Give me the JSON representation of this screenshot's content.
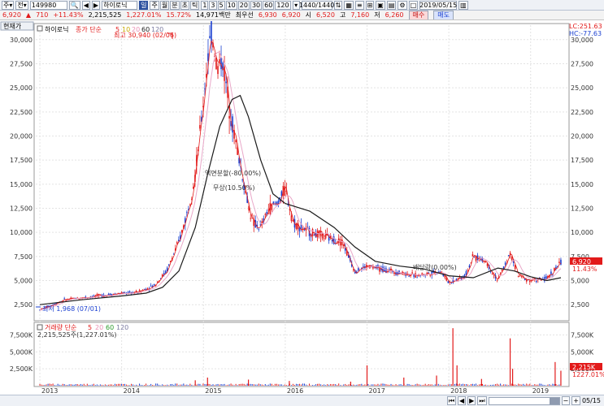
{
  "toolbar": {
    "period": "주",
    "market": "전",
    "code": "149980",
    "name": "하이로닉",
    "chart_type": "일",
    "intervals": [
      "주",
      "월",
      "분",
      "초",
      "틱"
    ],
    "minute_steps": [
      "1",
      "3",
      "5",
      "10",
      "20",
      "30",
      "60",
      "120"
    ],
    "bar_count": "1440/1440",
    "date": "2019/05/15"
  },
  "quote": {
    "price": "6,920",
    "change_arrow": "▲",
    "change": "710",
    "change_pct": "+11.43%",
    "volume": "2,215,525",
    "volume_pct": "1,227.01%",
    "turnover": "15.72%",
    "amount": "14,971백만",
    "label_priority": "최우선",
    "ask": "6,930",
    "bid": "6,920",
    "open_label": "시",
    "open": "6,520",
    "high_label": "고",
    "high": "7,160",
    "low_label": "저",
    "low": "6,260",
    "buy_label": "매수",
    "sell_label": "매도"
  },
  "price_panel": {
    "left_badge": "현재가",
    "legend_name": "하이로닉",
    "legend_prefix": "종가 단순",
    "ma_periods": [
      "5",
      "10",
      "20",
      "60",
      "120"
    ],
    "lc": "LC:251.63",
    "hc": "HC:-77.63",
    "current_tag": "6,920",
    "current_pct": "11.43%",
    "high_note": "최고 30,940 (02/06)",
    "low_note": "최저 1,968 (07/01)",
    "ann_split": "액면분할(-80.00%)",
    "ann_bonus": "무상(10.50%)",
    "ann_dividend": "배당락(0.00%)"
  },
  "volume_panel": {
    "legend": "거래량 단순",
    "ma_periods": [
      "5",
      "20",
      "60",
      "120"
    ],
    "current_vol": "2,215,525주(1,227.01%)",
    "tag_vol": "2,215K",
    "tag_pct": "1227.01%"
  },
  "bottom": {
    "date_end": "05/15"
  },
  "colors": {
    "up": "#e21a1a",
    "down": "#1a3fd0",
    "ma5": "#e21a1a",
    "ma10": "#e8c800",
    "ma20": "#e9a8c9",
    "ma60": "#1b1b1b",
    "ma120": "#7a7aa0"
  },
  "chart_data": [
    {
      "type": "line",
      "x_labels": [
        "2013",
        "2014",
        "2015",
        "2016",
        "2017",
        "2018",
        "2019"
      ],
      "ylim": [
        1000,
        31500
      ],
      "y_ticks": [
        "2,500",
        "5,000",
        "7,500",
        "10,000",
        "12,500",
        "15,000",
        "17,500",
        "20,000",
        "22,500",
        "25,000",
        "27,500",
        "30,000"
      ],
      "close": [
        {
          "x": 2013.0,
          "y": 1968
        },
        {
          "x": 2013.3,
          "y": 3000
        },
        {
          "x": 2013.6,
          "y": 3300
        },
        {
          "x": 2013.9,
          "y": 3600
        },
        {
          "x": 2014.2,
          "y": 3800
        },
        {
          "x": 2014.4,
          "y": 4500
        },
        {
          "x": 2014.55,
          "y": 6000
        },
        {
          "x": 2014.7,
          "y": 9000
        },
        {
          "x": 2014.8,
          "y": 12000
        },
        {
          "x": 2014.9,
          "y": 16000
        },
        {
          "x": 2014.98,
          "y": 22000
        },
        {
          "x": 2015.05,
          "y": 28000
        },
        {
          "x": 2015.1,
          "y": 30940
        },
        {
          "x": 2015.17,
          "y": 27000
        },
        {
          "x": 2015.23,
          "y": 28000
        },
        {
          "x": 2015.3,
          "y": 24000
        },
        {
          "x": 2015.38,
          "y": 20000
        },
        {
          "x": 2015.45,
          "y": 17000
        },
        {
          "x": 2015.52,
          "y": 14000
        },
        {
          "x": 2015.6,
          "y": 11000
        },
        {
          "x": 2015.7,
          "y": 10500
        },
        {
          "x": 2015.8,
          "y": 12500
        },
        {
          "x": 2015.9,
          "y": 13000
        },
        {
          "x": 2016.0,
          "y": 14500
        },
        {
          "x": 2016.1,
          "y": 11000
        },
        {
          "x": 2016.3,
          "y": 10000
        },
        {
          "x": 2016.5,
          "y": 9500
        },
        {
          "x": 2016.7,
          "y": 9000
        },
        {
          "x": 2016.85,
          "y": 6000
        },
        {
          "x": 2017.0,
          "y": 6500
        },
        {
          "x": 2017.3,
          "y": 6000
        },
        {
          "x": 2017.6,
          "y": 5500
        },
        {
          "x": 2017.9,
          "y": 6000
        },
        {
          "x": 2018.0,
          "y": 4800
        },
        {
          "x": 2018.2,
          "y": 5500
        },
        {
          "x": 2018.3,
          "y": 7500
        },
        {
          "x": 2018.45,
          "y": 7000
        },
        {
          "x": 2018.6,
          "y": 5000
        },
        {
          "x": 2018.75,
          "y": 7800
        },
        {
          "x": 2018.85,
          "y": 5500
        },
        {
          "x": 2019.0,
          "y": 5000
        },
        {
          "x": 2019.2,
          "y": 5200
        },
        {
          "x": 2019.37,
          "y": 6920
        }
      ],
      "ma60": [
        {
          "x": 2013.0,
          "y": 2500
        },
        {
          "x": 2013.5,
          "y": 3000
        },
        {
          "x": 2014.0,
          "y": 3400
        },
        {
          "x": 2014.3,
          "y": 3700
        },
        {
          "x": 2014.5,
          "y": 4300
        },
        {
          "x": 2014.7,
          "y": 6000
        },
        {
          "x": 2014.9,
          "y": 10500
        },
        {
          "x": 2015.05,
          "y": 16000
        },
        {
          "x": 2015.2,
          "y": 21000
        },
        {
          "x": 2015.35,
          "y": 23800
        },
        {
          "x": 2015.45,
          "y": 24200
        },
        {
          "x": 2015.55,
          "y": 22000
        },
        {
          "x": 2015.7,
          "y": 17500
        },
        {
          "x": 2015.85,
          "y": 14000
        },
        {
          "x": 2016.0,
          "y": 13000
        },
        {
          "x": 2016.3,
          "y": 12200
        },
        {
          "x": 2016.6,
          "y": 10500
        },
        {
          "x": 2016.85,
          "y": 8500
        },
        {
          "x": 2017.1,
          "y": 7000
        },
        {
          "x": 2017.4,
          "y": 6500
        },
        {
          "x": 2017.7,
          "y": 6200
        },
        {
          "x": 2018.0,
          "y": 5500
        },
        {
          "x": 2018.3,
          "y": 5300
        },
        {
          "x": 2018.6,
          "y": 6300
        },
        {
          "x": 2018.8,
          "y": 6000
        },
        {
          "x": 2019.0,
          "y": 5400
        },
        {
          "x": 2019.2,
          "y": 5000
        },
        {
          "x": 2019.37,
          "y": 5300
        }
      ]
    },
    {
      "type": "bar",
      "x_labels": [
        "2013",
        "2014",
        "2015",
        "2016",
        "2017",
        "2018",
        "2019"
      ],
      "ylim": [
        0,
        9000
      ],
      "y_ticks": [
        "2,500K",
        "5,000K",
        "7,500K"
      ],
      "spikes": [
        {
          "x": 2014.9,
          "y": 800
        },
        {
          "x": 2015.05,
          "y": 1200
        },
        {
          "x": 2015.55,
          "y": 900
        },
        {
          "x": 2016.05,
          "y": 700
        },
        {
          "x": 2016.8,
          "y": 600
        },
        {
          "x": 2017.0,
          "y": 3000
        },
        {
          "x": 2017.45,
          "y": 1200
        },
        {
          "x": 2017.85,
          "y": 1500
        },
        {
          "x": 2018.05,
          "y": 8500
        },
        {
          "x": 2018.1,
          "y": 3000
        },
        {
          "x": 2018.4,
          "y": 1000
        },
        {
          "x": 2018.75,
          "y": 7000
        },
        {
          "x": 2018.78,
          "y": 2500
        },
        {
          "x": 2019.3,
          "y": 3500
        },
        {
          "x": 2019.37,
          "y": 2215
        }
      ]
    }
  ]
}
